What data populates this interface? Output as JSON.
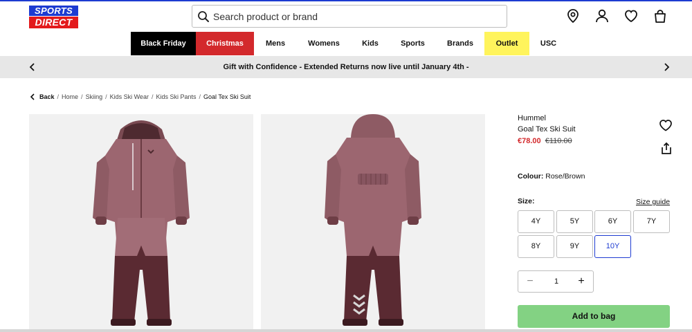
{
  "logo": {
    "line1": "SPORTS",
    "line2": "DIRECT"
  },
  "search": {
    "placeholder": "Search product or brand"
  },
  "header_icons": [
    "location-pin-icon",
    "account-icon",
    "wishlist-heart-icon",
    "bag-icon"
  ],
  "nav": [
    {
      "label": "Black Friday"
    },
    {
      "label": "Christmas"
    },
    {
      "label": "Mens"
    },
    {
      "label": "Womens"
    },
    {
      "label": "Kids"
    },
    {
      "label": "Sports"
    },
    {
      "label": "Brands"
    },
    {
      "label": "Outlet"
    },
    {
      "label": "USC"
    }
  ],
  "promo": {
    "text": "Gift with Confidence - Extended Returns now live until January 4th  -"
  },
  "breadcrumb": {
    "back": "Back",
    "items": [
      "Home",
      "Skiing",
      "Kids Ski Wear",
      "Kids Ski Pants",
      "Goal Tex Ski Suit"
    ]
  },
  "product": {
    "brand": "Hummel",
    "name": "Goal Tex Ski Suit",
    "price_now": "€78.00",
    "price_was": "€110.00",
    "colour_label": "Colour:",
    "colour_value": "Rose/Brown",
    "size_label": "Size:",
    "size_guide": "Size guide",
    "sizes": [
      "4Y",
      "5Y",
      "6Y",
      "7Y",
      "8Y",
      "9Y",
      "10Y"
    ],
    "selected_size": "10Y",
    "quantity": "1",
    "add_to_bag": "Add to bag"
  },
  "colors": {
    "brand_blue": "#1d3bd1",
    "brand_red": "#e31a1c",
    "price_red": "#d3292c",
    "outlet_yellow": "#fff45c",
    "add_bag_green": "#83d283",
    "suit_rose": "#9c6670",
    "suit_brown": "#5a2a32"
  }
}
